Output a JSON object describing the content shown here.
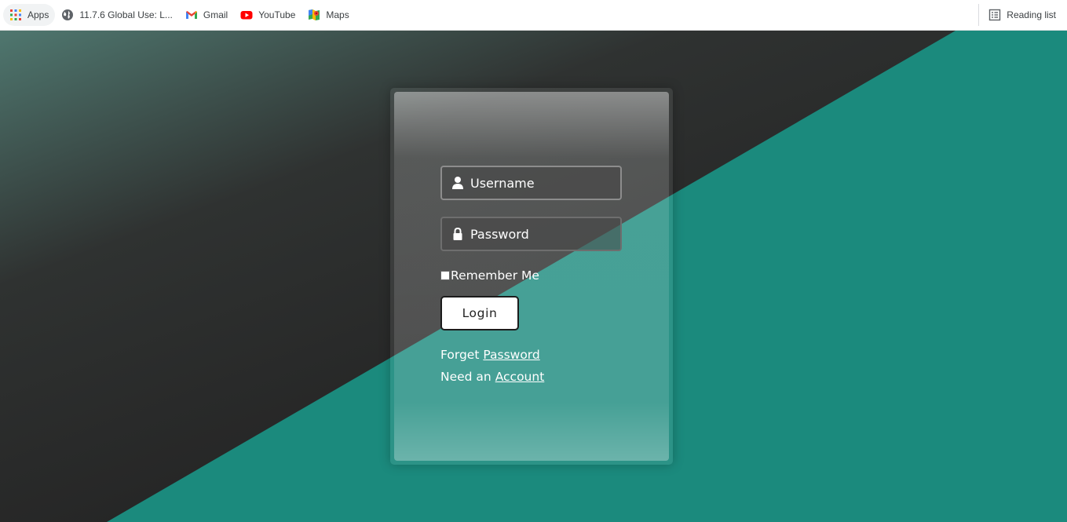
{
  "bookmarks": {
    "items": [
      {
        "label": "Apps",
        "icon": "apps-grid-icon"
      },
      {
        "label": "11.7.6 Global Use: L...",
        "icon": "globe-icon"
      },
      {
        "label": "Gmail",
        "icon": "gmail-icon"
      },
      {
        "label": "YouTube",
        "icon": "youtube-icon"
      },
      {
        "label": "Maps",
        "icon": "maps-icon"
      }
    ],
    "reading_list": {
      "label": "Reading list",
      "icon": "reading-list-icon"
    }
  },
  "colors": {
    "teal": "#1b8a7d",
    "dark": "#2a2a2a",
    "field_border": "#8d8d8d"
  },
  "login": {
    "username_placeholder": "Username",
    "password_placeholder": "Password",
    "remember_label": "Remember Me",
    "login_label": "Login",
    "forget_prefix": "Forget",
    "forget_link": "Password",
    "need_prefix": "Need an",
    "need_link": "Account"
  }
}
